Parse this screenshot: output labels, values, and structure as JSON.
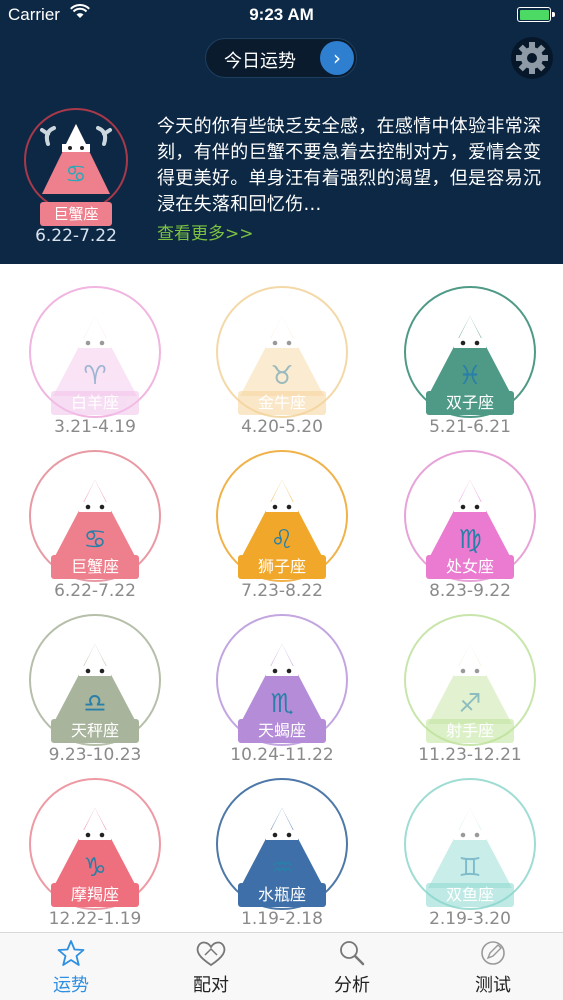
{
  "status_bar": {
    "carrier": "Carrier",
    "time": "9:23 AM"
  },
  "header": {
    "title": "今日运势"
  },
  "today": {
    "sign": "巨蟹座",
    "date": "6.22-7.22",
    "fortune": "今天的你有些缺乏安全感，在感情中体验非常深刻，有伴的巨蟹不要急着去控制对方，爱情会变得更美好。单身汪有着强烈的渴望，但是容易沉浸在失落和回忆伤…",
    "read_more": "查看更多>>"
  },
  "signs": [
    {
      "name": "白羊座",
      "date": "3.21-4.19",
      "color": "#f2c2ea",
      "ring": "#f0b5e0",
      "glyph": "♈",
      "faded": true
    },
    {
      "name": "金牛座",
      "date": "4.20-5.20",
      "color": "#f6d49a",
      "ring": "#f3d9a8",
      "glyph": "♉",
      "faded": true
    },
    {
      "name": "双子座",
      "date": "5.21-6.21",
      "color": "#4f9a86",
      "ring": "#4f9a86",
      "glyph": "♓",
      "faded": false
    },
    {
      "name": "巨蟹座",
      "date": "6.22-7.22",
      "color": "#ee7f8c",
      "ring": "#e89aa4",
      "glyph": "♋",
      "faded": false
    },
    {
      "name": "狮子座",
      "date": "7.23-8.22",
      "color": "#f0a72a",
      "ring": "#f0b24a",
      "glyph": "♌",
      "faded": false
    },
    {
      "name": "处女座",
      "date": "8.23-9.22",
      "color": "#ea7bd0",
      "ring": "#e7a3d8",
      "glyph": "♍",
      "faded": false
    },
    {
      "name": "天秤座",
      "date": "9.23-10.23",
      "color": "#a8b49c",
      "ring": "#b5bfa9",
      "glyph": "♎",
      "faded": false
    },
    {
      "name": "天蝎座",
      "date": "10.24-11.22",
      "color": "#b48cd8",
      "ring": "#c3a6e0",
      "glyph": "♏",
      "faded": false
    },
    {
      "name": "射手座",
      "date": "11.23-12.21",
      "color": "#bfe49a",
      "ring": "#c8e6ab",
      "glyph": "♐",
      "faded": true
    },
    {
      "name": "摩羯座",
      "date": "12.22-1.19",
      "color": "#ee6f7e",
      "ring": "#ee9aa4",
      "glyph": "♑",
      "faded": false
    },
    {
      "name": "水瓶座",
      "date": "1.19-2.18",
      "color": "#3f6fa8",
      "ring": "#4d78a8",
      "glyph": "♒",
      "faded": false
    },
    {
      "name": "双鱼座",
      "date": "2.19-3.20",
      "color": "#8ad8cf",
      "ring": "#9fdcd4",
      "glyph": "♊",
      "faded": true
    }
  ],
  "tabs": [
    {
      "label": "运势",
      "icon": "star-icon",
      "active": true
    },
    {
      "label": "配对",
      "icon": "heart-icon",
      "active": false
    },
    {
      "label": "分析",
      "icon": "magnifier-icon",
      "active": false
    },
    {
      "label": "测试",
      "icon": "pencil-circle-icon",
      "active": false
    }
  ],
  "colors": {
    "header_bg": "#0c2844",
    "accent_blue": "#2f8fe0",
    "link_green": "#7cc142"
  }
}
